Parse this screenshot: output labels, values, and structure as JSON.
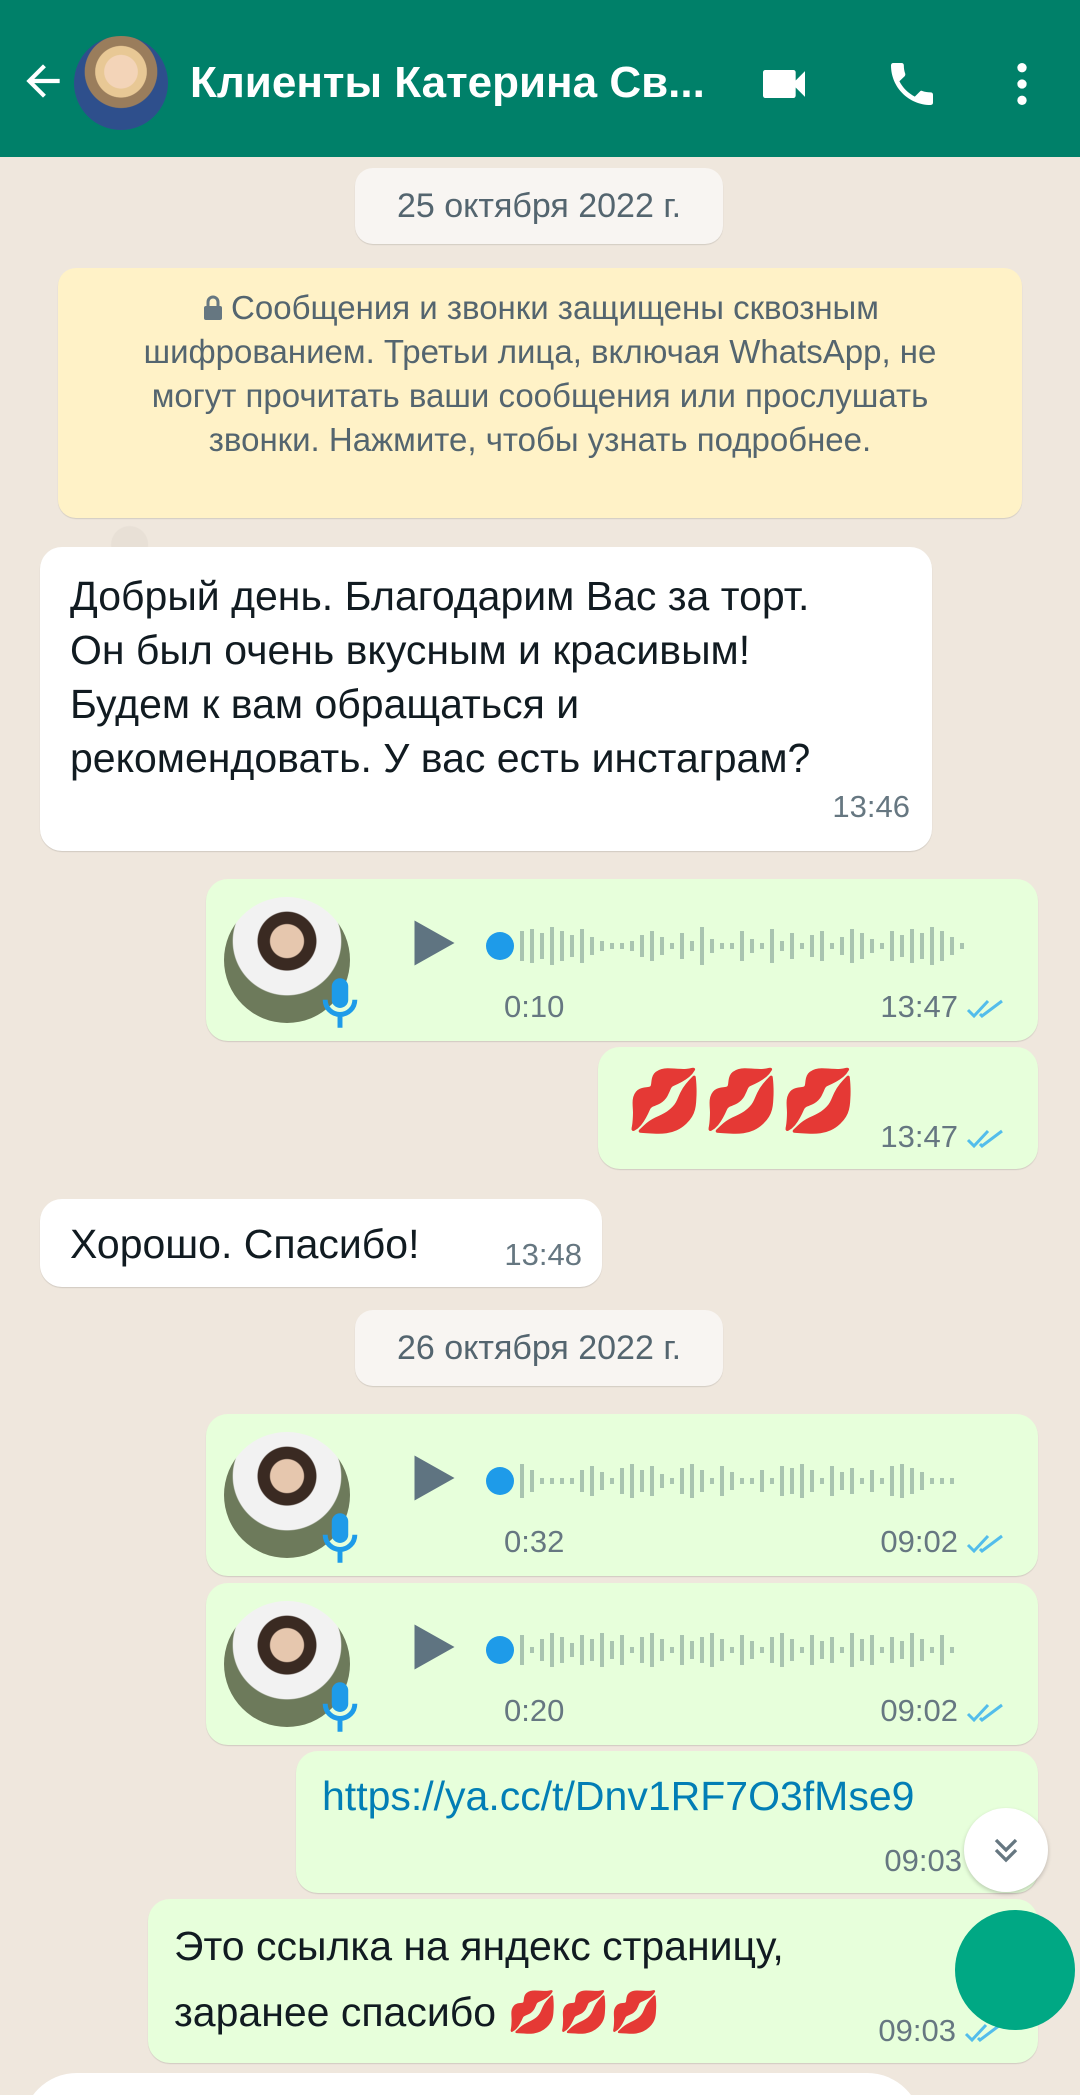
{
  "header": {
    "contact_name": "Клиенты Катерина Св..."
  },
  "dates": {
    "first": "25 октября 2022 г.",
    "second": "26 октября 2022 г."
  },
  "encryption_notice": "Сообщения и звонки защищены сквозным шифрованием. Третьи лица, включая WhatsApp, не могут прочитать ваши сообщения или прослушать звонки. Нажмите, чтобы узнать подробнее.",
  "messages": [
    {
      "dir": "in",
      "type": "text",
      "text": "Добрый день. Благодарим Вас за торт. Он был очень вкусным и красивым! Будем к вам обращаться и рекомендовать. У вас есть инстаграм?",
      "time": "13:46"
    },
    {
      "dir": "out",
      "type": "voice",
      "duration": "0:10",
      "time": "13:47"
    },
    {
      "dir": "out",
      "type": "emoji",
      "text": "💋💋💋",
      "time": "13:47"
    },
    {
      "dir": "in",
      "type": "text",
      "text": "Хорошо. Спасибо!",
      "time": "13:48"
    },
    {
      "dir": "out",
      "type": "voice",
      "duration": "0:32",
      "time": "09:02"
    },
    {
      "dir": "out",
      "type": "voice",
      "duration": "0:20",
      "time": "09:02"
    },
    {
      "dir": "out",
      "type": "link",
      "text": "https://ya.cc/t/Dnv1RF7O3fMse9",
      "time": "09:03"
    },
    {
      "dir": "out",
      "type": "text",
      "text": "Это ссылка на яндекс страницу, заранее спасибо 💋💋💋",
      "time": "09:03"
    }
  ],
  "colors": {
    "header": "#008069",
    "incoming": "#ffffff",
    "outgoing": "#e7ffdb",
    "read_ticks": "#53bdeb",
    "link": "#027eb5"
  }
}
